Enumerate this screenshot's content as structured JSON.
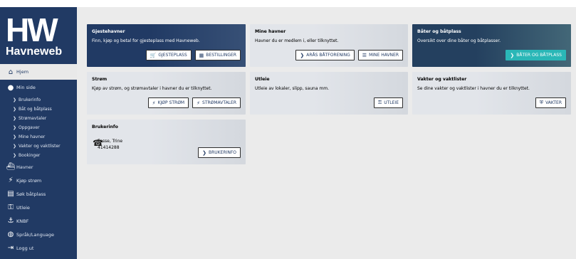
{
  "brand": {
    "mark": "HW",
    "name": "Havneweb"
  },
  "nav": {
    "home": "Hjem",
    "my_page": "Min side",
    "sub": [
      "Brukerinfo",
      "Båt og båtplass",
      "Strømavtaler",
      "Oppgaver",
      "Mine havner",
      "Vakter og vaktlister",
      "Bookinger"
    ],
    "harbors": "Havner",
    "buy_power": "Kjøp strøm",
    "search_berth": "Søk båtplass",
    "rental": "Utleie",
    "knbf": "KNBF",
    "language": "Språk/Language",
    "logout": "Logg ut"
  },
  "cards": {
    "guest": {
      "title": "Gjestehavner",
      "desc": "Finn, kjøp og betal for gjesteplass med Havneweb.",
      "btn1": "GJESTEPLASS",
      "btn2": "BESTILLINGER"
    },
    "my_harbors": {
      "title": "Mine havner",
      "desc": "Havner du er medlem i, eller tilknyttet.",
      "btn1": "ARÅS BÅTFORENING",
      "btn2": "MINE HAVNER"
    },
    "boats": {
      "title": "Båter og båtplass",
      "desc": "Oversikt over dine båter og båtplasser.",
      "btn1": "BÅTER OG BÅTPLASS"
    },
    "power": {
      "title": "Strøm",
      "desc": "Kjøp av strøm, og strømavtaler i havner du er tilknyttet.",
      "btn1": "KJØP STRØM",
      "btn2": "STRØMAVTALER"
    },
    "rental": {
      "title": "Utleie",
      "desc": "Utleie av lokaler, slipp, sauna mm.",
      "btn1": "UTLEIE"
    },
    "guards": {
      "title": "Vakter og vaktlister",
      "desc": "Se dine vakter og vaktlister i havner du er tilknyttet.",
      "btn1": "VAKTER"
    },
    "userinfo": {
      "title": "Brukerinfo",
      "name": "Fosse, Trine",
      "phone": "41414288",
      "btn1": "BRUKERINFO"
    }
  },
  "colors": {
    "sidebar": "#213a64",
    "teal": "#2ab7b7",
    "main_bg": "#ebebeb"
  }
}
